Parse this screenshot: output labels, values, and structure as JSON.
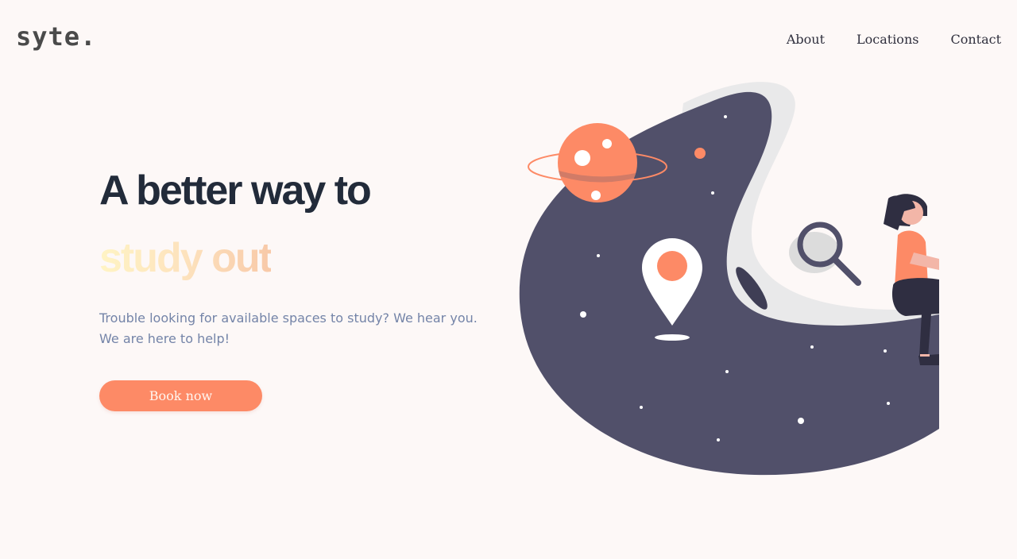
{
  "brand": {
    "logo_text": "syte."
  },
  "nav": {
    "about": "About",
    "locations": "Locations",
    "contact": "Contact"
  },
  "hero": {
    "title": "A better way to",
    "subtitle": "study out",
    "description": "Trouble looking for available spaces to study? We hear you. We are here to help!",
    "cta_label": "Book now"
  },
  "colors": {
    "background": "#fdf8f7",
    "accent": "#fd8a66",
    "dark": "#222b3a",
    "illustration_dark": "#51506a"
  }
}
